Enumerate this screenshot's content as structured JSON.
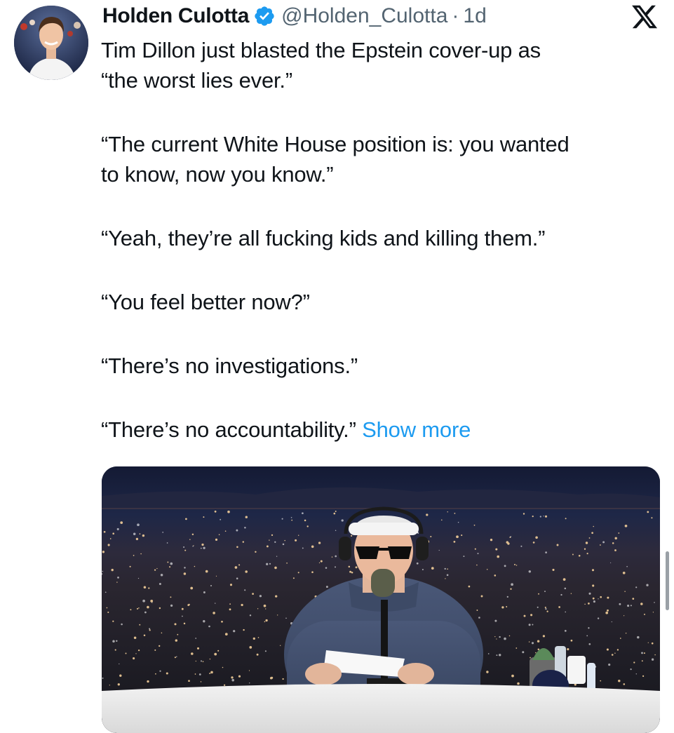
{
  "tweet": {
    "author": {
      "name": "Holden Culotta",
      "handle": "@Holden_Culotta",
      "verified": true
    },
    "separator": "·",
    "age": "1d",
    "lines": [
      "Tim Dillon just blasted the Epstein cover-up as",
      "“the worst lies ever.”",
      "“The current White House position is: you wanted",
      "to know, now you know.”",
      "“Yeah, they’re all fucking kids and killing them.”",
      "“You feel better now?”",
      "“There’s no investigations.”",
      "“There’s no accountability.”"
    ],
    "show_more": "Show more"
  },
  "icons": {
    "platform": "x-logo-icon",
    "verified": "verified-badge-icon"
  },
  "colors": {
    "link": "#1d9bf0",
    "verified": "#1d9bf0",
    "muted": "#536471",
    "text": "#0f1419"
  }
}
